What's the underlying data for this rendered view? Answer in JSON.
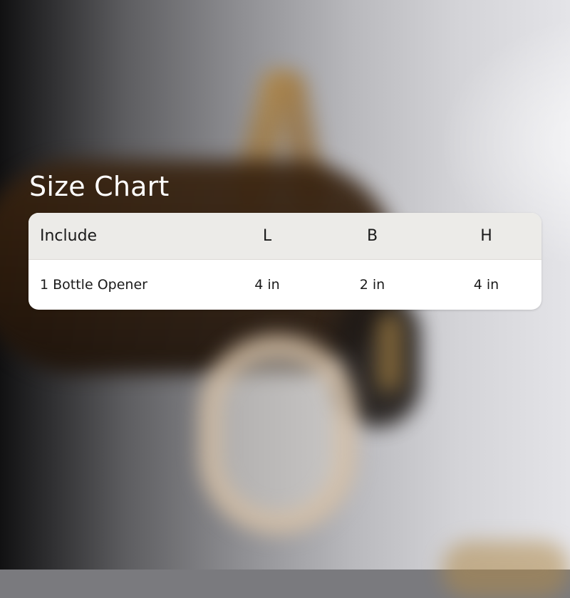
{
  "title": "Size Chart",
  "table": {
    "headers": [
      "Include",
      "L",
      "B",
      "H"
    ],
    "rows": [
      [
        "1 Bottle Opener",
        "4 in",
        "2 in",
        "4 in"
      ]
    ]
  }
}
